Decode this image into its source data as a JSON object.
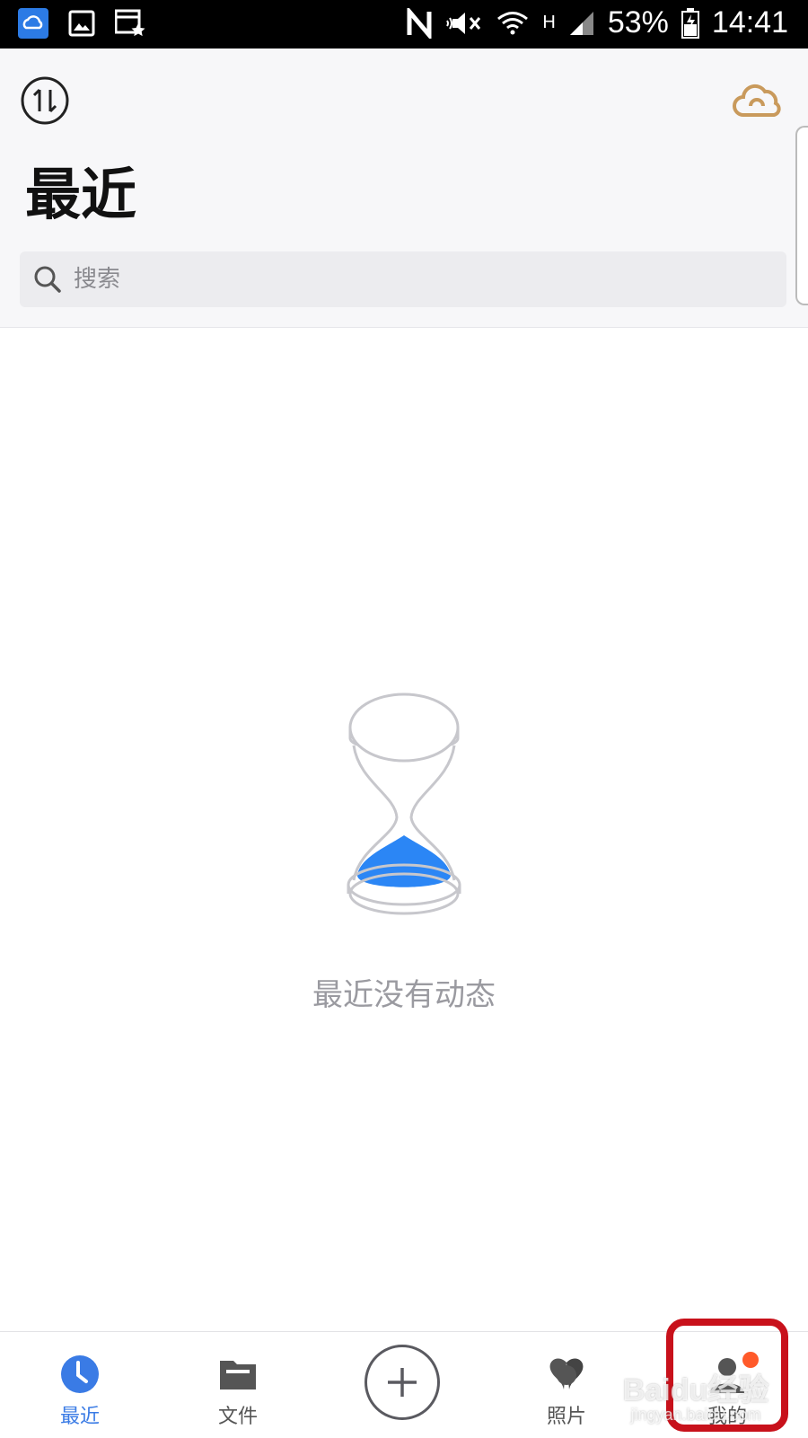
{
  "status_bar": {
    "battery_percent": "53%",
    "time": "14:41",
    "network_type": "H",
    "icons_left": [
      "baidu-cloud-notification-icon",
      "gallery-icon",
      "calendar-star-icon"
    ],
    "icons_right": [
      "nfc-icon",
      "mute-icon",
      "wifi-icon",
      "signal-icon",
      "battery-icon"
    ]
  },
  "header": {
    "title": "最近",
    "transfer_icon": "transfer-updown-icon",
    "cloud_icon": "cloud-icon",
    "accent_color": "#c99a5c"
  },
  "search": {
    "placeholder": "搜索",
    "value": ""
  },
  "empty_state": {
    "message": "最近没有动态",
    "illustration": "hourglass-icon",
    "sand_color": "#2b86f5"
  },
  "bottom_nav": {
    "items": [
      {
        "label": "最近",
        "icon": "clock-icon",
        "active": true
      },
      {
        "label": "文件",
        "icon": "folder-icon",
        "active": false
      },
      {
        "label": "",
        "icon": "plus-icon",
        "active": false
      },
      {
        "label": "照片",
        "icon": "photos-icon",
        "active": false
      },
      {
        "label": "我的",
        "icon": "person-icon",
        "active": false,
        "badge": true
      }
    ],
    "active_color": "#3a7be5",
    "badge_color": "#ff5a2a"
  },
  "annotation": {
    "highlight_color": "#c8111b",
    "watermark_main": "Baidu经验",
    "watermark_sub": "jingyan.baidu.com"
  }
}
